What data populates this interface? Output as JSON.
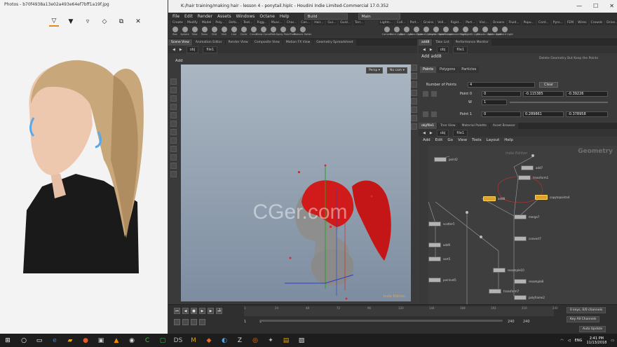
{
  "photos": {
    "title": "Photos - b70f4938a13e02a493e64ef7bff1a19f.jpg",
    "toolbar": [
      "draw-ballpoint",
      "draw-pencil",
      "draw-calligraphy",
      "eraser",
      "crop",
      "close"
    ]
  },
  "houdini": {
    "title": "K:/hair training/making hair - lesson 4 - ponytail.hiplc - Houdini Indie Limited-Commercial 17.0.352",
    "window_buttons": [
      "—",
      "☐",
      "✕"
    ],
    "menu": [
      "File",
      "Edit",
      "Render",
      "Assets",
      "Windows",
      "Octane",
      "Help"
    ],
    "desktop_dropdown": "Build",
    "main_dropdown": "Main",
    "shelf_left_tabs": [
      "Create",
      "Modify",
      "Model",
      "Poly...",
      "Defo...",
      "Text...",
      "Rigg...",
      "Musc...",
      "Char...",
      "Con...",
      "Hair...",
      "Gui...",
      "Guid...",
      "Terr..."
    ],
    "shelf_left_icons": [
      "Box",
      "Sphere",
      "Tube",
      "Torus",
      "Grid",
      "Null",
      "Line",
      "Circle",
      "Curve",
      "Draw Curve",
      "Path",
      "Spray Paint",
      "Font",
      "Platonic Solids"
    ],
    "shelf_right_tabs": [
      "Lights...",
      "Coll...",
      "Part...",
      "Grains",
      "Vell...",
      "Rigid...",
      "Part...",
      "Visc...",
      "Oceans",
      "Fluid...",
      "Popu...",
      "Cont...",
      "Pyro...",
      "FEM",
      "Wires",
      "Crowds",
      "Drive..."
    ],
    "shelf_right_icons": [
      "Camera",
      "Point Light",
      "Spot Light",
      "Area Light",
      "Geometry Light",
      "Volume Light",
      "Distant Light",
      "Environment Light",
      "Sky Light",
      "GI Light",
      "Caustic Light",
      "Portal Light",
      "Ambient Light"
    ]
  },
  "scene": {
    "tabs": [
      "Scene View",
      "Animation Editor",
      "Render View",
      "Composite View",
      "Motion FX View",
      "Geometry Spreadsheet"
    ],
    "path": [
      "obj",
      "file1"
    ],
    "label": "Add",
    "persp": "Persp ▾",
    "nocam": "No cam ▾",
    "watermark": "CGer.com",
    "status": "Indie Edition"
  },
  "params": {
    "tabs": [
      "add8",
      "Take List",
      "Performance Monitor"
    ],
    "path": [
      "obj",
      "file1"
    ],
    "header": "Add  add8",
    "note": "Delete Geometry But Keep the Points",
    "subtabs": [
      "Points",
      "Polygons",
      "Particles"
    ],
    "num_points_label": "Number of Points",
    "num_points": "4",
    "clear": "Clear",
    "point0_label": "Point 0",
    "point0": [
      "0",
      "-0.115385",
      "-0.39226"
    ],
    "w_label": "W",
    "w_value": "1",
    "point1_label": "Point 1",
    "point1": [
      "0",
      "0.289861",
      "-0.378958"
    ]
  },
  "network": {
    "tabs": [
      "obj/file1",
      "Tree View",
      "Material Palette",
      "Asset Browser"
    ],
    "path": [
      "obj",
      "file1"
    ],
    "menu": [
      "Add",
      "Edit",
      "Go",
      "View",
      "Tools",
      "Layout",
      "Help"
    ],
    "title": "Geometry",
    "subtitle": "Indie Edition",
    "nodes": [
      {
        "name": "point2",
        "sel": false
      },
      {
        "name": "add7",
        "sel": false
      },
      {
        "name": "transform1",
        "sel": false
      },
      {
        "name": "copytopoints4",
        "sel": true
      },
      {
        "name": "add8",
        "sel": true
      },
      {
        "name": "merge7",
        "sel": false
      },
      {
        "name": "scatter5",
        "sel": false
      },
      {
        "name": "add9",
        "sel": false
      },
      {
        "name": "sort5",
        "sel": false
      },
      {
        "name": "convert7",
        "sel": false
      },
      {
        "name": "pointvel5",
        "sel": false
      },
      {
        "name": "resample10",
        "sel": false
      },
      {
        "name": "resample8",
        "sel": false
      },
      {
        "name": "transform7",
        "sel": false
      },
      {
        "name": "polyframe2",
        "sel": false
      }
    ]
  },
  "timeline": {
    "frame": "1",
    "ticks": [
      "1",
      "24",
      "48",
      "72",
      "96",
      "120",
      "144",
      "168",
      "192",
      "216",
      "240"
    ],
    "start": "1",
    "start2": "1",
    "end": "240",
    "end2": "240",
    "keys": "0 keys, 0/0 channels",
    "key_all": "Key All Channels",
    "auto_update": "Auto Update"
  },
  "taskbar": {
    "lang": "ENG",
    "time": "2:41 PM",
    "date": "11/13/2018"
  }
}
